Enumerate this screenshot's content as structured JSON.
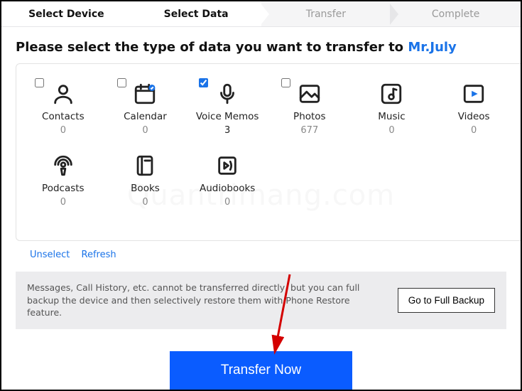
{
  "stepper": {
    "steps": [
      "Select Device",
      "Select Data",
      "Transfer",
      "Complete"
    ],
    "activeIndex": 1
  },
  "prompt": {
    "text": "Please select the type of data you want to transfer to ",
    "device": "Mr.July"
  },
  "items": [
    {
      "id": "contacts",
      "label": "Contacts",
      "count": "0",
      "checked": false
    },
    {
      "id": "calendar",
      "label": "Calendar",
      "count": "0",
      "checked": false
    },
    {
      "id": "voicememos",
      "label": "Voice Memos",
      "count": "3",
      "checked": true
    },
    {
      "id": "photos",
      "label": "Photos",
      "count": "677",
      "checked": false
    },
    {
      "id": "music",
      "label": "Music",
      "count": "0",
      "checked": false
    },
    {
      "id": "videos",
      "label": "Videos",
      "count": "0",
      "checked": false
    },
    {
      "id": "podcasts",
      "label": "Podcasts",
      "count": "0",
      "checked": false
    },
    {
      "id": "books",
      "label": "Books",
      "count": "0",
      "checked": false
    },
    {
      "id": "audiobooks",
      "label": "Audiobooks",
      "count": "0",
      "checked": false
    }
  ],
  "links": {
    "unselect": "Unselect",
    "refresh": "Refresh"
  },
  "note": {
    "message": "Messages, Call History, etc. cannot be transferred directly, but you can full backup the device and then selectively restore them with Phone Restore feature.",
    "button": "Go to Full Backup"
  },
  "primary": "Transfer Now",
  "watermark": "Quantrimang.com"
}
